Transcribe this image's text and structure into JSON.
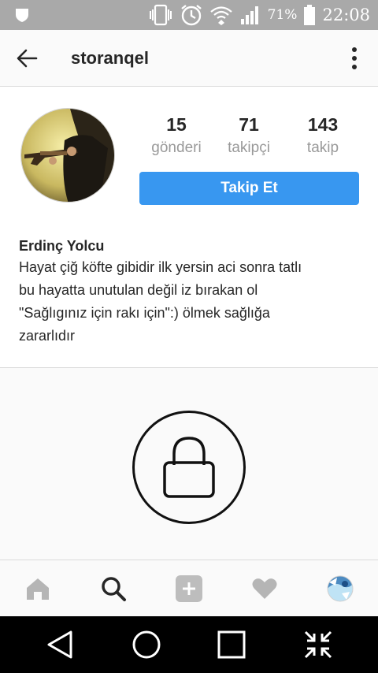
{
  "status_bar": {
    "battery_percent": "71%",
    "time": "22:08"
  },
  "app_bar": {
    "username": "storanqel"
  },
  "profile": {
    "stats": [
      {
        "value": "15",
        "label": "gönderi"
      },
      {
        "value": "71",
        "label": "takipçi"
      },
      {
        "value": "143",
        "label": "takip"
      }
    ],
    "follow_label": "Takip Et",
    "display_name": "Erdinç Yolcu",
    "bio_lines": [
      "Hayat çiğ köfte gibidir ilk yersin aci sonra tatlı",
      "bu hayatta unutulan değil iz bırakan ol",
      "\"Sağlıgınız için rakı için\":) ölmek sağlığa",
      "zararlıdır"
    ]
  },
  "colors": {
    "accent": "#3897f0",
    "status_bar": "#a9a9a9",
    "nav_bar": "#000000"
  },
  "icons": [
    "back-arrow-icon",
    "more-vert-icon",
    "lock-icon",
    "home-icon",
    "search-icon",
    "add-icon",
    "heart-icon",
    "profile-avatar-icon",
    "nav-back-icon",
    "nav-home-icon",
    "nav-recents-icon",
    "nav-collapse-icon"
  ]
}
